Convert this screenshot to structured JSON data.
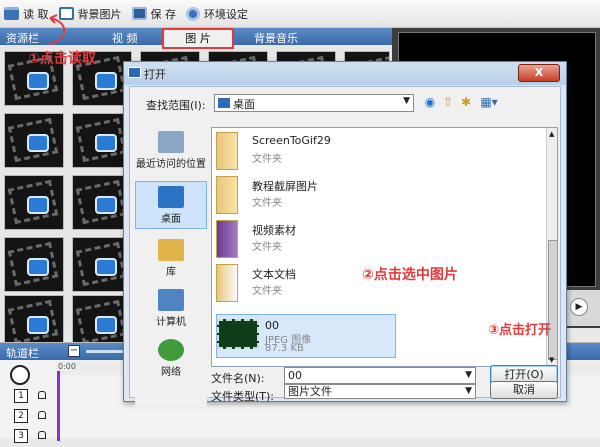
{
  "toolbar": {
    "read_label": "读 取",
    "bg_pic_label": "背景图片",
    "save_label": "保 存",
    "env_label": "环境设定"
  },
  "resource": {
    "title": "资源栏",
    "tabs": [
      "视 频",
      "图 片",
      "背景音乐"
    ]
  },
  "track": {
    "title": "轨道栏",
    "ruler_start": "0:00"
  },
  "annotations": {
    "step1": "①点击读取",
    "step2": "②点击选中图片",
    "step3": "③点击打开"
  },
  "dialog": {
    "title": "打开",
    "close": "X",
    "look_in_label": "查找范围(I):",
    "look_in_value": "桌面",
    "places": [
      "最近访问的位置",
      "桌面",
      "库",
      "计算机",
      "网络"
    ],
    "files": [
      {
        "name": "ScreenToGif29",
        "kind": "文件夹"
      },
      {
        "name": "教程截屏图片",
        "kind": "文件夹"
      },
      {
        "name": "视频素材",
        "kind": "文件夹"
      },
      {
        "name": "文本文档",
        "kind": "文件夹"
      },
      {
        "name": "00",
        "kind": "JPEG 图像",
        "size": "87.3 KB"
      }
    ],
    "filename_label": "文件名(N):",
    "filename_value": "00",
    "filetype_label": "文件类型(T):",
    "filetype_value": "图片文件",
    "open_button": "打开(O)",
    "cancel_button": "取消"
  },
  "track_rows": [
    "1",
    "2",
    "3"
  ],
  "colors": {
    "annotation": "#e23b3b",
    "header_blue": "#4a7cbc",
    "selection": "#cde4fb"
  }
}
